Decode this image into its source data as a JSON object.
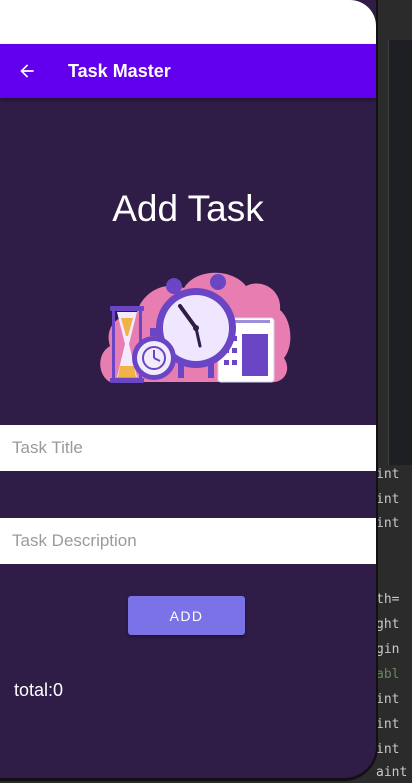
{
  "app_bar": {
    "title": "Task Master",
    "back_icon": "arrow-left-icon"
  },
  "screen": {
    "heading": "Add Task",
    "illustration": "clock-illustration"
  },
  "form": {
    "title_placeholder": "Task Title",
    "title_value": "",
    "description_placeholder": "Task Description",
    "description_value": "",
    "add_button_label": "ADD"
  },
  "footer": {
    "total_label": "total:0"
  },
  "colors": {
    "app_bar": "#6200ee",
    "background": "#2f1c47",
    "button": "#7b72e8"
  },
  "background_editor": {
    "lines": [
      "int",
      "int",
      "int",
      "th=",
      "ght",
      "gin",
      "abl",
      "int",
      "int",
      "int",
      "aint"
    ]
  }
}
